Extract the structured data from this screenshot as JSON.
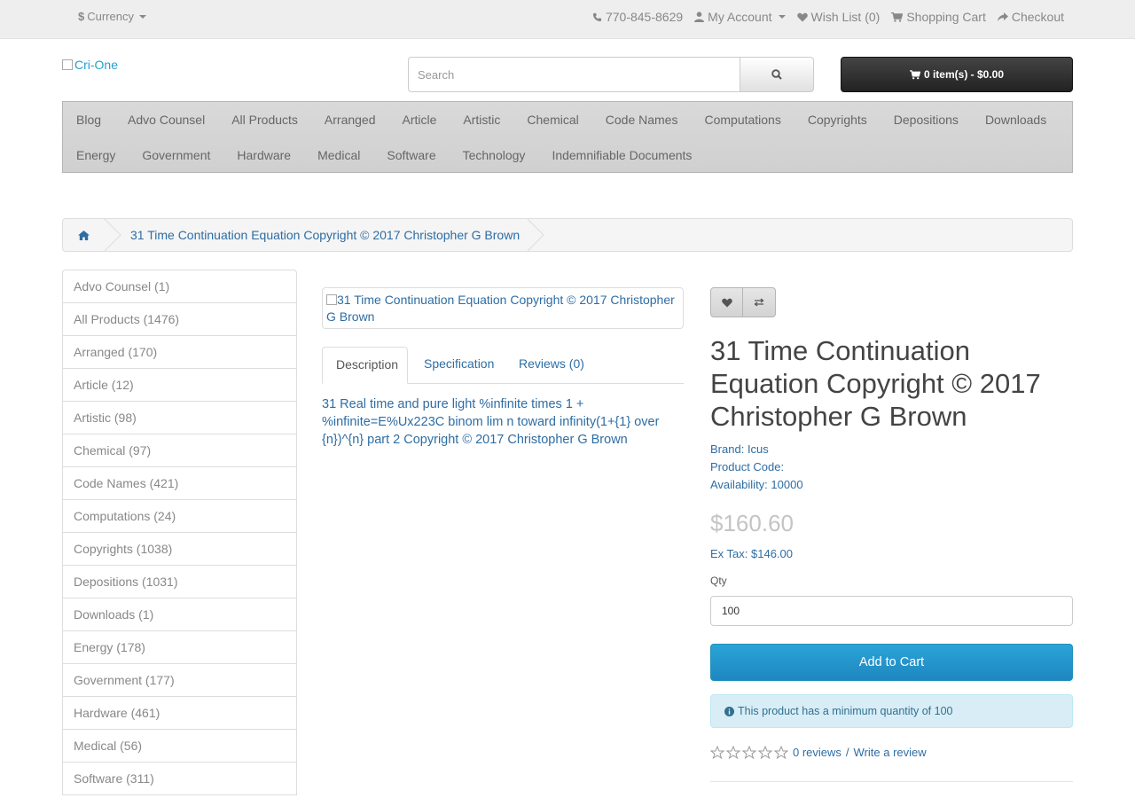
{
  "topbar": {
    "currency_symbol": "$",
    "currency_label": "Currency",
    "phone": "770-845-8629",
    "my_account": "My Account",
    "wish_list": "Wish List (0)",
    "shopping_cart": "Shopping Cart",
    "checkout": "Checkout"
  },
  "header": {
    "logo_alt": "Cri-One",
    "search_placeholder": "Search",
    "cart_label": "0 item(s) - $0.00"
  },
  "menu": {
    "row1": [
      "Blog",
      "Advo Counsel",
      "All Products",
      "Arranged",
      "Article",
      "Artistic",
      "Chemical",
      "Code Names",
      "Computations",
      "Copyrights",
      "Depositions",
      "Downloads"
    ],
    "row2": [
      "Energy",
      "Government",
      "Hardware",
      "Medical",
      "Software",
      "Technology",
      "Indemnifiable Documents"
    ]
  },
  "breadcrumb": {
    "current": "31 Time Continuation Equation Copyright © 2017 Christopher G Brown"
  },
  "sidebar": {
    "items": [
      "Advo Counsel (1)",
      "All Products (1476)",
      "Arranged (170)",
      "Article (12)",
      "Artistic (98)",
      "Chemical (97)",
      "Code Names (421)",
      "Computations (24)",
      "Copyrights (1038)",
      "Depositions (1031)",
      "Downloads (1)",
      "Energy (178)",
      "Government (177)",
      "Hardware (461)",
      "Medical (56)",
      "Software (311)"
    ]
  },
  "product": {
    "image_alt": "31 Time Continuation Equation Copyright © 2017 Christopher G Brown",
    "tabs": [
      "Description",
      "Specification",
      "Reviews (0)"
    ],
    "description": "31 Real time and pure light  %infinite times 1 + %infinite=E%Ux223C binom lim n toward infinity(1+{1} over {n})^{n} part 2 Copyright © 2017 Christopher G Brown",
    "title": "31 Time Continuation Equation Copyright © 2017 Christopher G Brown",
    "brand_label": "Brand:",
    "brand": "Icus",
    "product_code_label": "Product Code:",
    "availability_label": "Availability:",
    "availability": "10000",
    "price": "$160.60",
    "ex_tax": "Ex Tax: $146.00",
    "qty_label": "Qty",
    "qty_value": "100",
    "add_to_cart": "Add to Cart",
    "min_qty_notice": "This product has a minimum quantity of 100",
    "rating_stars": 0,
    "reviews_link": "0 reviews",
    "review_sep": "/",
    "write_review": "Write a review"
  },
  "colors": {
    "link": "#2e6da4",
    "primary_button": "#229ac8",
    "alert_bg": "#d9edf7"
  }
}
